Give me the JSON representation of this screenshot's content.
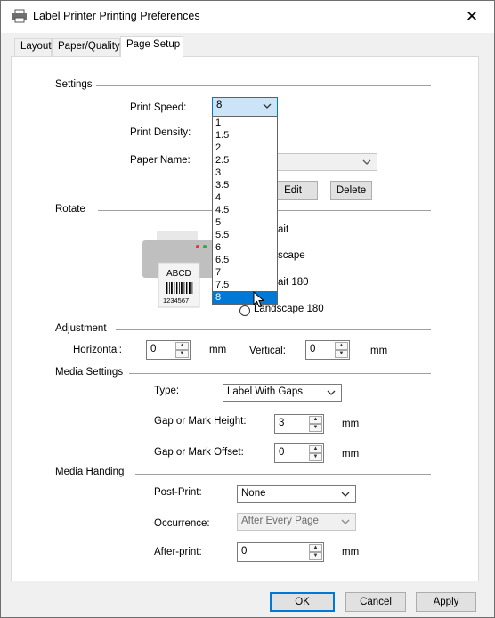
{
  "window": {
    "title": "Label Printer Printing Preferences"
  },
  "tabs": [
    {
      "label": "Layout",
      "active": false
    },
    {
      "label": "Paper/Quality",
      "active": false
    },
    {
      "label": "Page Setup",
      "active": true
    }
  ],
  "settings": {
    "section_label": "Settings",
    "print_speed_label": "Print Speed:",
    "print_speed_value": "8",
    "print_density_label": "Print Density:",
    "paper_name_label": "Paper Name:",
    "edit_label": "Edit",
    "delete_label": "Delete"
  },
  "speed_options": [
    "1",
    "1.5",
    "2",
    "2.5",
    "3",
    "3.5",
    "4",
    "4.5",
    "5",
    "5.5",
    "6",
    "6.5",
    "7",
    "7.5",
    "8"
  ],
  "selected_speed": "8",
  "rotate": {
    "section_label": "Rotate",
    "options_visible": [
      "ait",
      "scape",
      "ait 180",
      "Landscape 180"
    ],
    "preview_text": "ABCD",
    "preview_barcode_digits": "1234567"
  },
  "adjustment": {
    "section_label": "Adjustment",
    "horizontal_label": "Horizontal:",
    "horizontal_value": "0",
    "horizontal_unit": "mm",
    "vertical_label": "Vertical:",
    "vertical_value": "0",
    "vertical_unit": "mm"
  },
  "media_settings": {
    "section_label": "Media Settings",
    "type_label": "Type:",
    "type_value": "Label With Gaps",
    "gap_height_label": "Gap or Mark Height:",
    "gap_height_value": "3",
    "gap_height_unit": "mm",
    "gap_offset_label": "Gap or Mark Offset:",
    "gap_offset_value": "0",
    "gap_offset_unit": "mm"
  },
  "media_handing": {
    "section_label": "Media Handing",
    "post_print_label": "Post-Print:",
    "post_print_value": "None",
    "occurrence_label": "Occurrence:",
    "occurrence_value": "After Every Page",
    "after_print_label": "After-print:",
    "after_print_value": "0",
    "after_print_unit": "mm"
  },
  "footer": {
    "ok_label": "OK",
    "cancel_label": "Cancel",
    "apply_label": "Apply"
  },
  "colors": {
    "accent": "#0078d7",
    "preview_printer": "#bfbfbf"
  }
}
